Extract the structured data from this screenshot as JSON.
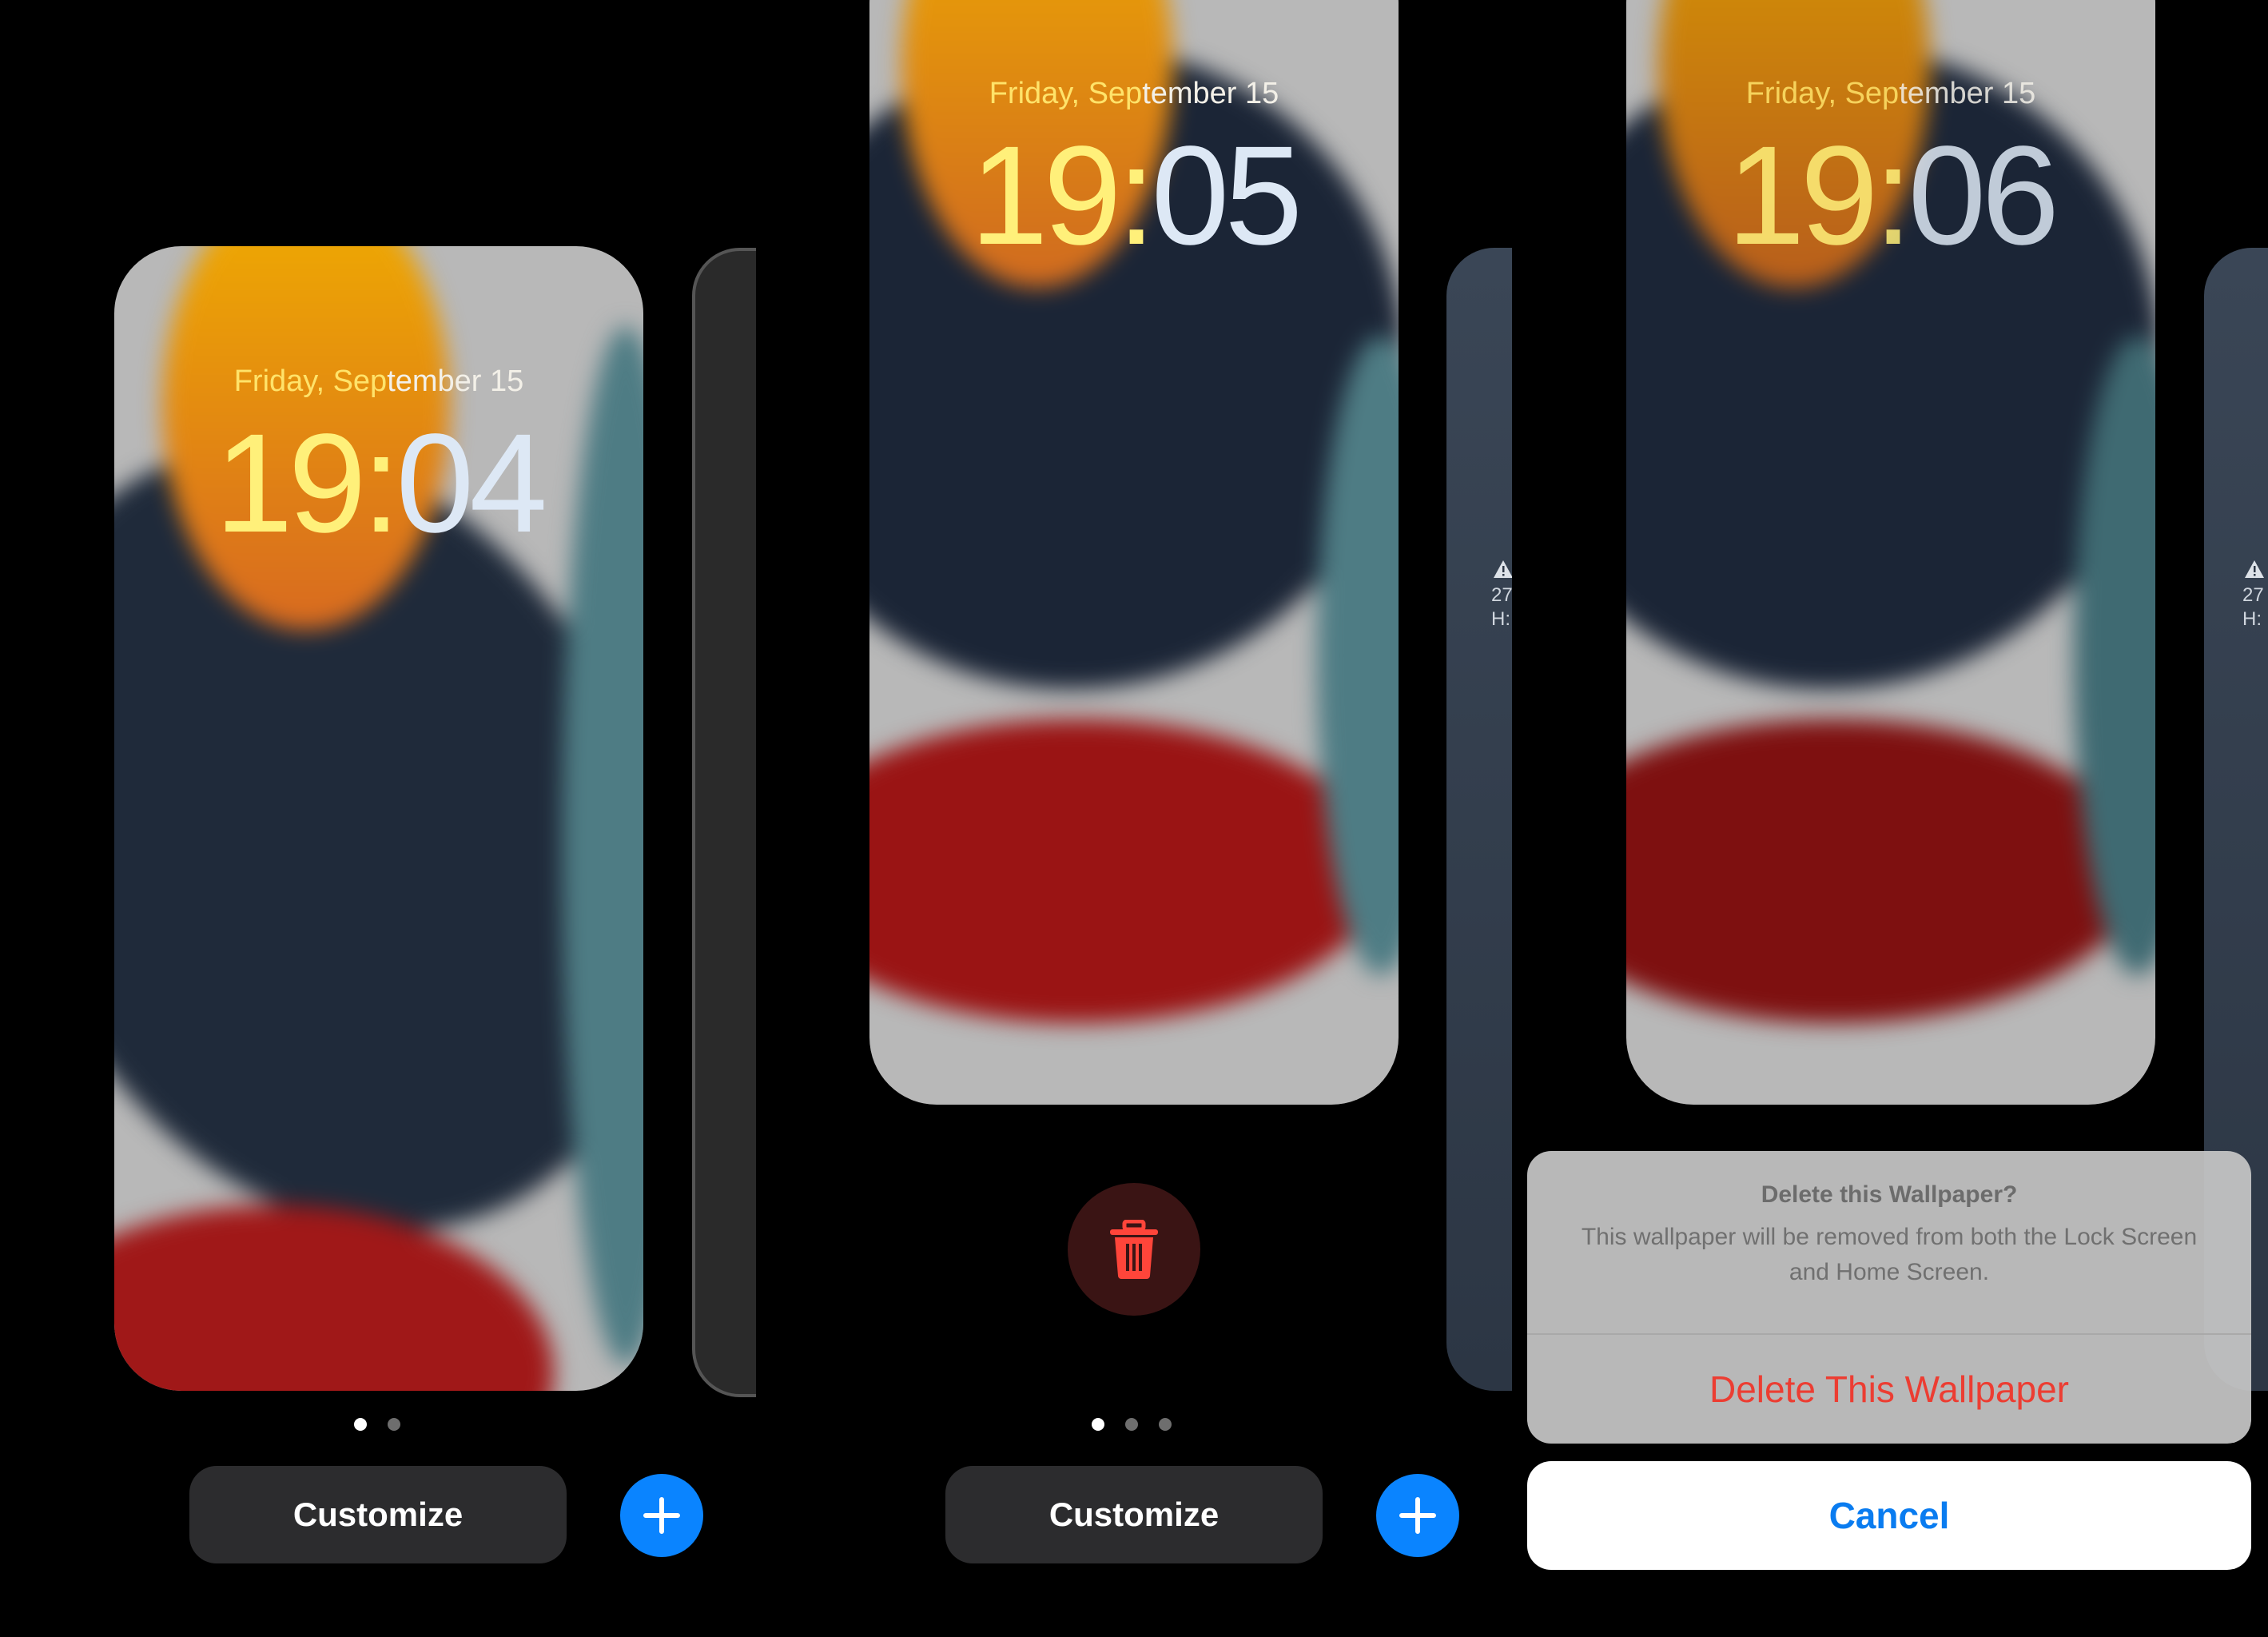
{
  "panels": [
    {
      "lock_screen": {
        "date_yellow": "Friday, Sep",
        "date_white": "tember 15",
        "time_yellow": "19:",
        "time_white": "04"
      },
      "page_dots": {
        "count": 2,
        "active": 1
      },
      "customize_label": "Customize",
      "add_button_icon": "plus-icon"
    },
    {
      "lock_screen": {
        "date_yellow": "Friday, Sep",
        "date_white": "tember 15",
        "time_yellow": "19:",
        "time_white": "05"
      },
      "delete_button_icon": "trash-icon",
      "page_dots": {
        "count": 3,
        "active": 1
      },
      "customize_label": "Customize",
      "add_button_icon": "plus-icon",
      "peek_card": {
        "warning_icon": "warning-triangle-icon",
        "line1": "27",
        "line2": "H:"
      }
    },
    {
      "lock_screen": {
        "date_yellow": "Friday, Sep",
        "date_white": "tember 15",
        "time_yellow": "19:",
        "time_white": "06"
      },
      "peek_card": {
        "warning_icon": "warning-triangle-icon",
        "line1": "27",
        "line2": "H:"
      },
      "action_sheet": {
        "title": "Delete this Wallpaper?",
        "message": "This wallpaper will be removed from both the Lock Screen and Home Screen.",
        "destructive_label": "Delete This Wallpaper",
        "cancel_label": "Cancel"
      }
    }
  ],
  "colors": {
    "accent_blue": "#0a84ff",
    "destructive_red": "#ec3d32",
    "date_yellow": "#ffe36a"
  }
}
